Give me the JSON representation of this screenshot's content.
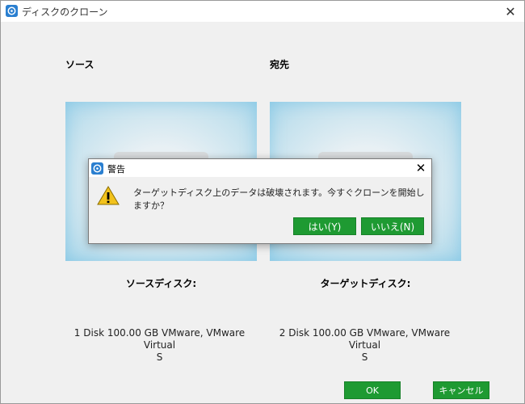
{
  "window": {
    "title": "ディスクのクローン",
    "close_symbol": "✕"
  },
  "labels": {
    "source": "ソース",
    "destination": "宛先"
  },
  "source_disk": {
    "caption": "ソースディスク:",
    "info_line1": "1 Disk 100.00 GB VMware,  VMware Virtual",
    "info_line2": "S"
  },
  "target_disk": {
    "caption": "ターゲットディスク:",
    "info_line1": "2 Disk 100.00 GB VMware,  VMware Virtual",
    "info_line2": "S"
  },
  "buttons": {
    "ok": "OK",
    "cancel": "キャンセル"
  },
  "dialog": {
    "title": "警告",
    "close_symbol": "✕",
    "message": "ターゲットディスク上のデータは破壊されます。今すぐクローンを開始しますか？",
    "yes": "はい(Y)",
    "no": "いいえ(N)"
  },
  "colors": {
    "accent_green": "#1e9a32",
    "panel_blue": "#a8d6ea",
    "app_icon_blue": "#2a7fd0",
    "warning_yellow": "#f2c21b"
  }
}
